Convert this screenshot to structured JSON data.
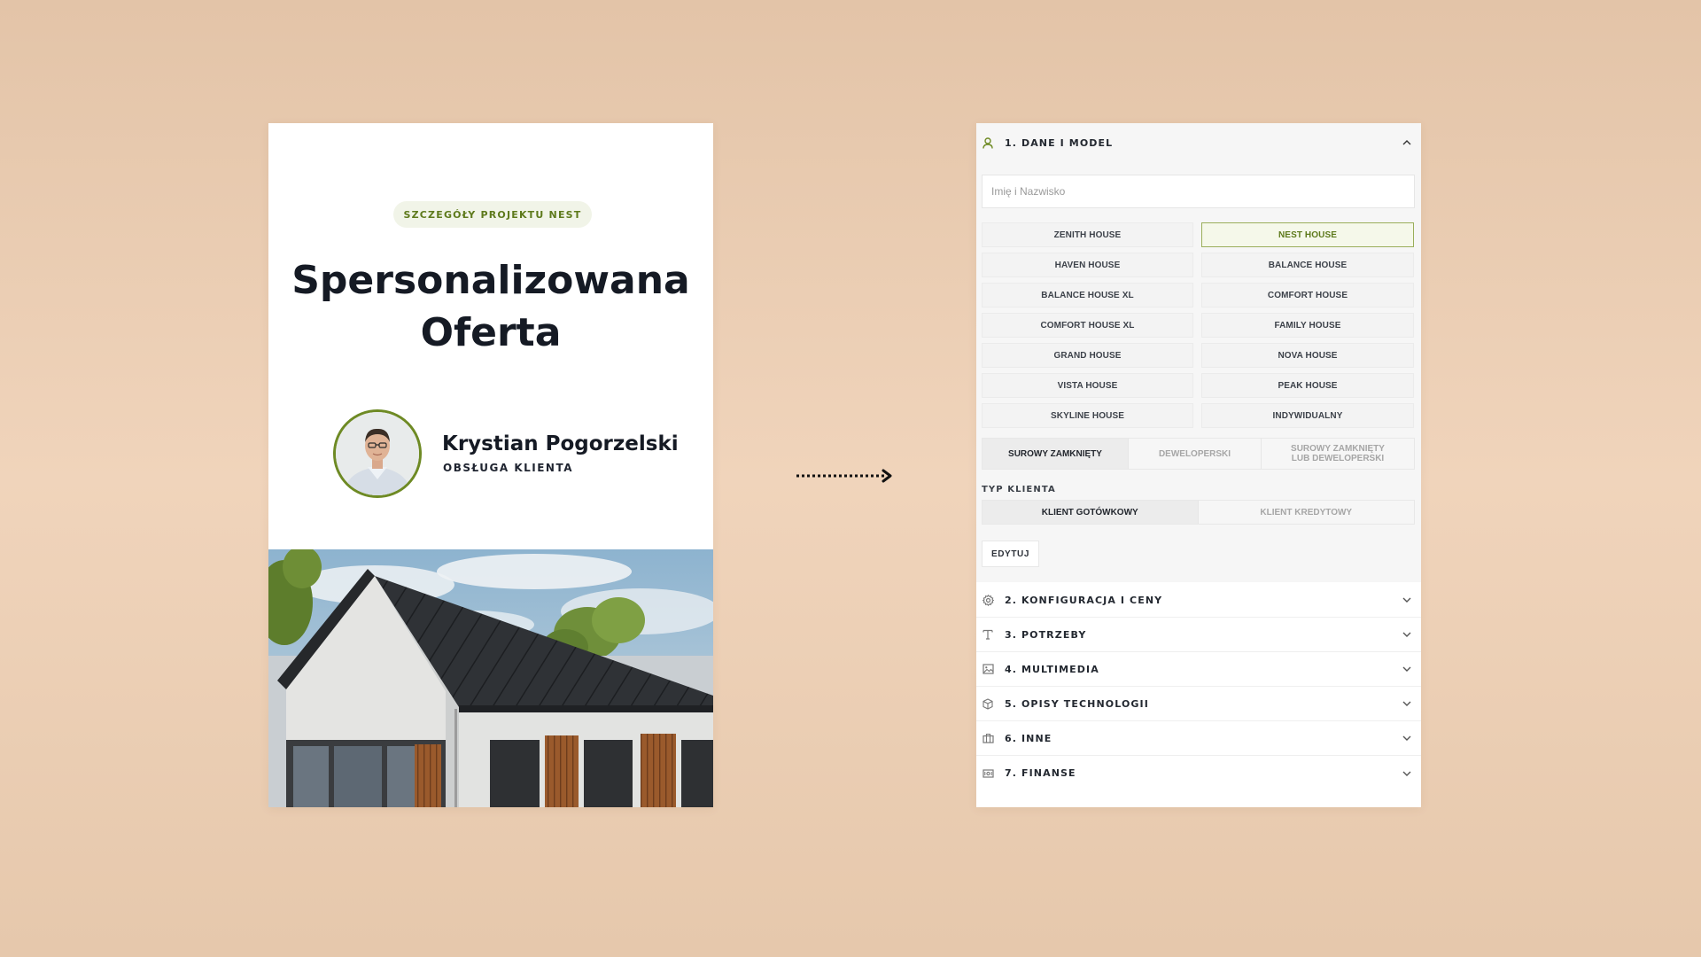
{
  "offer_card": {
    "badge": "SZCZEGÓŁY PROJEKTU NEST",
    "title_line1": "Spersonalizowana",
    "title_line2": "Oferta",
    "agent_name": "Krystian Pogorzelski",
    "agent_role": "OBSŁUGA KLIENTA"
  },
  "config_panel": {
    "section1_title": "1. DANE I MODEL",
    "name_placeholder": "Imię i Nazwisko",
    "models": [
      "ZENITH HOUSE",
      "NEST HOUSE",
      "HAVEN HOUSE",
      "BALANCE HOUSE",
      "BALANCE HOUSE XL",
      "COMFORT HOUSE",
      "COMFORT HOUSE XL",
      "FAMILY HOUSE",
      "GRAND HOUSE",
      "NOVA HOUSE",
      "VISTA HOUSE",
      "PEAK HOUSE",
      "SKYLINE HOUSE",
      "INDYWIDUALNY"
    ],
    "selected_model": "NEST HOUSE",
    "standards": {
      "surowy": "SUROWY ZAMKNIĘTY",
      "deweloperski": "DEWELOPERSKI",
      "either": "SUROWY ZAMKNIĘTY LUB DEWELOPERSKI"
    },
    "selected_standard": "SUROWY ZAMKNIĘTY",
    "client_type_label": "TYP KLIENTA",
    "client_types": {
      "cash": "KLIENT GOTÓWKOWY",
      "credit": "KLIENT KREDYTOWY"
    },
    "selected_client_type": "KLIENT GOTÓWKOWY",
    "edit_label": "EDYTUJ",
    "sections": [
      {
        "title": "2. KONFIGURACJA I CENY",
        "icon": "gear-icon"
      },
      {
        "title": "3. POTRZEBY",
        "icon": "text-icon"
      },
      {
        "title": "4. MULTIMEDIA",
        "icon": "image-icon"
      },
      {
        "title": "5. OPISY TECHNOLOGII",
        "icon": "box-icon"
      },
      {
        "title": "6. INNE",
        "icon": "briefcase-icon"
      },
      {
        "title": "7. FINANSE",
        "icon": "banknote-icon"
      }
    ]
  },
  "colors": {
    "accent_green": "#5e7a1c",
    "title_dark": "#151a24",
    "background": "#eccfb5"
  }
}
